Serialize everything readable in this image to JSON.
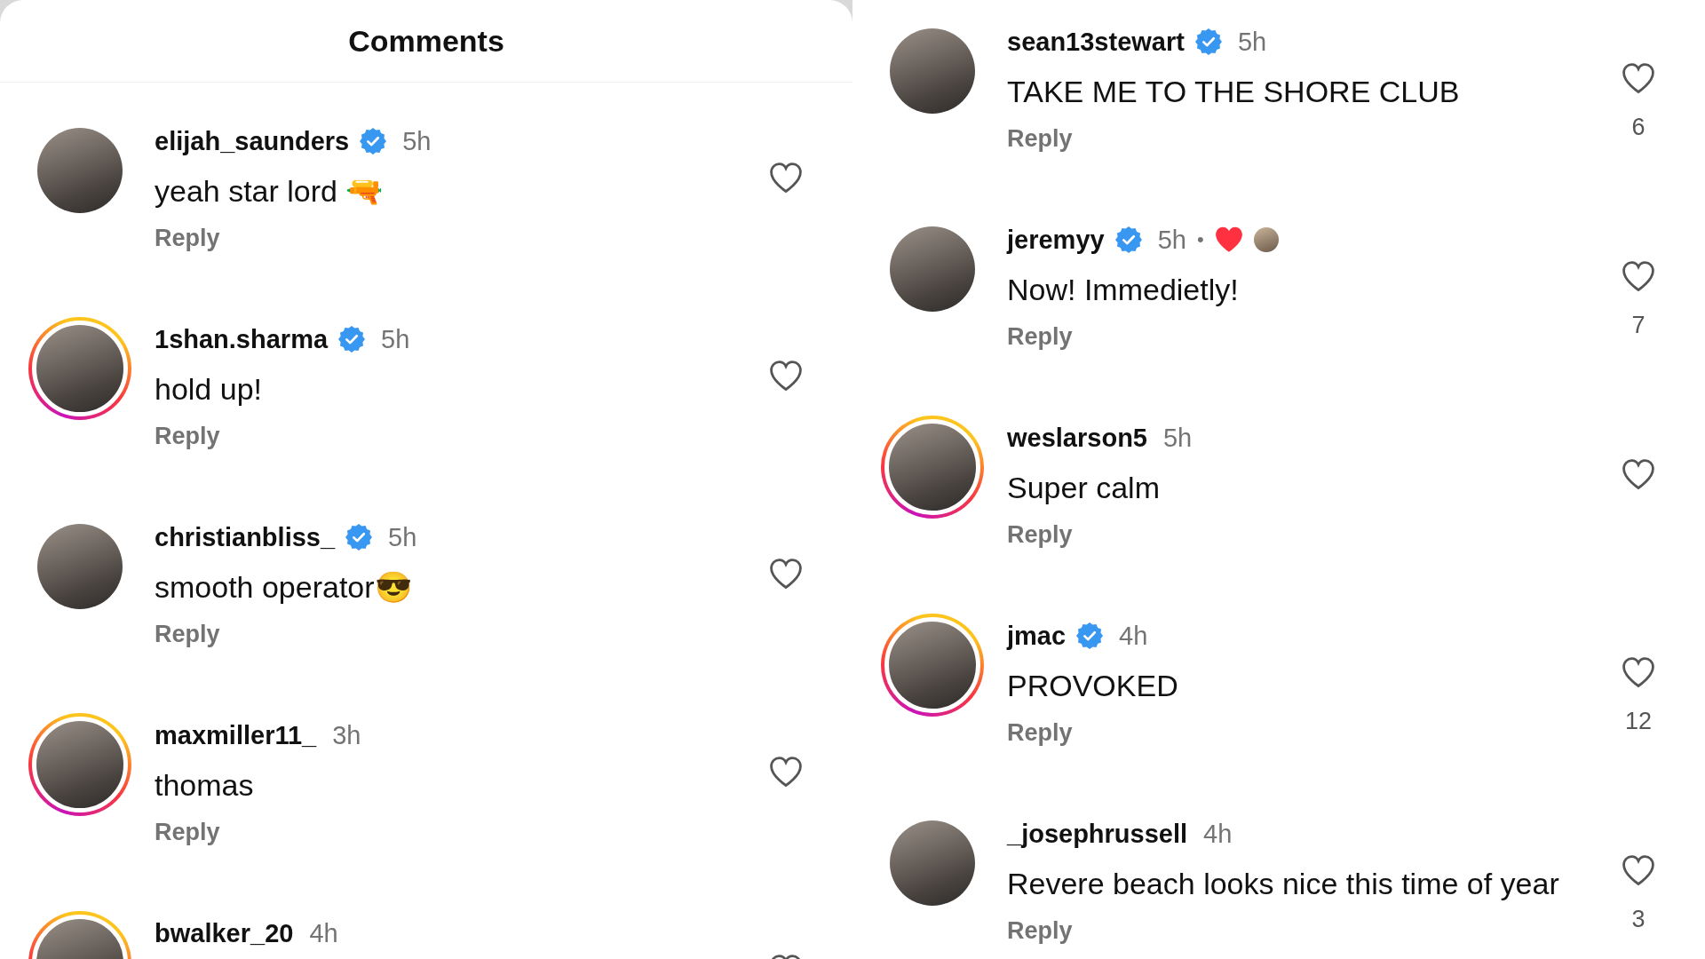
{
  "panels": [
    {
      "header": {
        "title": "Comments"
      },
      "comments": [
        {
          "username": "elijah_saunders",
          "verified": true,
          "time": "5h",
          "text": "yeah star lord 🔫",
          "reply": "Reply",
          "story_ring": false,
          "liked_by_author": false
        },
        {
          "username": "1shan.sharma",
          "verified": true,
          "time": "5h",
          "text": "hold up!",
          "reply": "Reply",
          "story_ring": true,
          "liked_by_author": false
        },
        {
          "username": "christianbliss_",
          "verified": true,
          "time": "5h",
          "text": "smooth operator😎",
          "reply": "Reply",
          "story_ring": false,
          "liked_by_author": false
        },
        {
          "username": "maxmiller11_",
          "verified": false,
          "time": "3h",
          "text": "thomas",
          "reply": "Reply",
          "story_ring": true,
          "liked_by_author": false
        },
        {
          "username": "bwalker_20",
          "verified": false,
          "time": "4h",
          "story_ring": true,
          "liked_by_author": false
        }
      ]
    },
    {
      "comments": [
        {
          "username": "sean13stewart",
          "verified": true,
          "time": "5h",
          "text": "TAKE ME TO THE SHORE CLUB",
          "reply": "Reply",
          "story_ring": false,
          "liked_by_author": false,
          "likes": "6"
        },
        {
          "username": "jeremyy",
          "verified": true,
          "time": "5h",
          "separator": "•",
          "text": "Now! Immedietly!",
          "reply": "Reply",
          "story_ring": false,
          "liked_by_author": true,
          "likes": "7"
        },
        {
          "username": "weslarson5",
          "verified": false,
          "time": "5h",
          "text": "Super calm",
          "reply": "Reply",
          "story_ring": true,
          "liked_by_author": false
        },
        {
          "username": "jmac",
          "verified": true,
          "time": "4h",
          "text": "PROVOKED",
          "reply": "Reply",
          "story_ring": true,
          "liked_by_author": false,
          "likes": "12"
        },
        {
          "username": "_josephrussell",
          "verified": false,
          "time": "4h",
          "text": "Revere beach looks nice this time of year",
          "reply": "Reply",
          "story_ring": false,
          "liked_by_author": false,
          "likes": "3"
        }
      ]
    }
  ]
}
